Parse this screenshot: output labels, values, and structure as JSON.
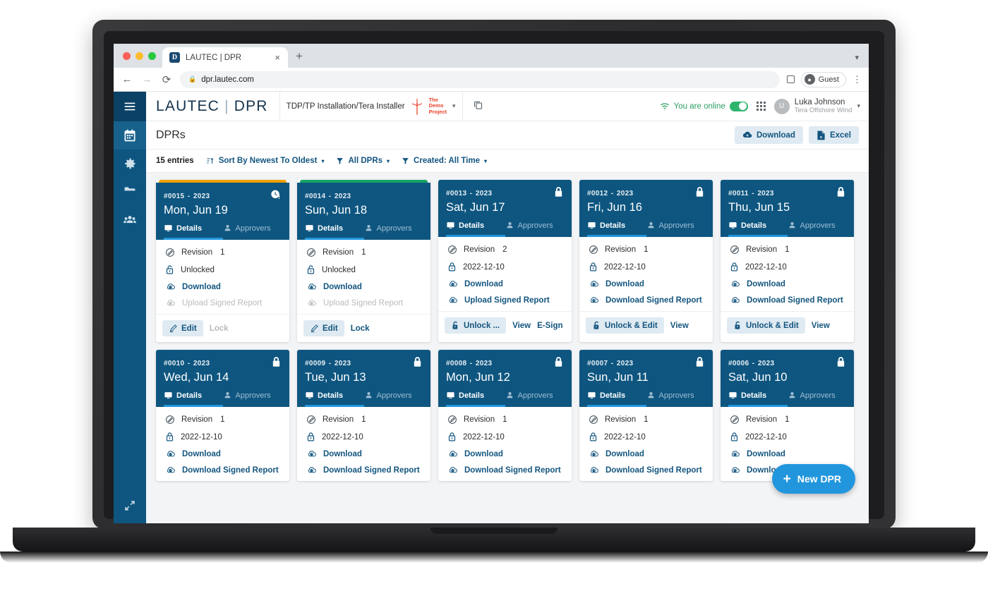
{
  "browser": {
    "tab_title": "LAUTEC | DPR",
    "tab_favicon_letter": "D",
    "new_tab_label": "+",
    "close_label": "×",
    "url": "dpr.lautec.com",
    "profile_label": "Guest"
  },
  "sidebar": {
    "items": [
      {
        "name": "menu-toggle",
        "icon": "hamburger-icon"
      },
      {
        "name": "calendar",
        "icon": "calendar-icon",
        "active": true
      },
      {
        "name": "settings",
        "icon": "gear-icon",
        "active": false
      },
      {
        "name": "files",
        "icon": "folder-icon",
        "active": false
      },
      {
        "name": "people",
        "icon": "people-icon",
        "active": false
      }
    ],
    "bottom_icon": "expand-arrows-icon"
  },
  "appbar": {
    "brand_primary": "LAUTEC",
    "brand_divider": "|",
    "brand_secondary": "DPR",
    "project_name": "TDP/TP Installation/Tera Installer",
    "project_badge_lines": [
      "The",
      "Demo",
      "Project"
    ],
    "project_caret": "▾",
    "copy_icon": "copy-icon",
    "online_text": "You are online",
    "online_color": "#2e9e62",
    "apps_icon": "app-grid-icon",
    "user_initial": "U",
    "user_name": "Luka Johnson",
    "user_org": "Tera Offshore Wind",
    "user_caret": "▾"
  },
  "page": {
    "title": "DPRs",
    "download_label": "Download",
    "excel_label": "Excel"
  },
  "filters": {
    "entries": "15 entries",
    "sort_label": "Sort By Newest To Oldest",
    "type_label": "All DPRs",
    "created_label": "Created: All Time",
    "caret": "▾"
  },
  "fab": {
    "label": "New DPR",
    "plus": "+",
    "color": "#2196dd"
  },
  "labels": {
    "details": "Details",
    "approvers": "Approvers",
    "revision": "Revision",
    "unlocked": "Unlocked",
    "download": "Download",
    "upload_signed": "Upload Signed Report",
    "download_signed": "Download Signed Report",
    "edit": "Edit",
    "lock": "Lock",
    "unlock_short": "Unlock ...",
    "unlock_edit": "Unlock & Edit",
    "view": "View",
    "esign": "E-Sign"
  },
  "cards": [
    {
      "id": "#0015",
      "sep": "-",
      "year": "2023",
      "date": "Mon, Jun 19",
      "accent": "orange",
      "status_icon": "clock-alert-icon",
      "revision": "1",
      "lock_row": "Unlocked",
      "lock_icon": "unlocked-icon",
      "download": "Download",
      "download_state": "link",
      "secondary": "Upload Signed Report",
      "secondary_state": "muted",
      "actions": [
        {
          "label": "Edit",
          "kind": "button",
          "icon": "pencil-icon"
        },
        {
          "label": "Lock",
          "kind": "link-muted"
        }
      ]
    },
    {
      "id": "#0014",
      "sep": "-",
      "year": "2023",
      "date": "Sun, Jun 18",
      "accent": "green",
      "status_icon": "",
      "revision": "1",
      "lock_row": "Unlocked",
      "lock_icon": "unlocked-icon",
      "download": "Download",
      "download_state": "link",
      "secondary": "Upload Signed Report",
      "secondary_state": "muted",
      "actions": [
        {
          "label": "Edit",
          "kind": "button",
          "icon": "pencil-icon"
        },
        {
          "label": "Lock",
          "kind": "link"
        }
      ]
    },
    {
      "id": "#0013",
      "sep": "-",
      "year": "2023",
      "date": "Sat, Jun 17",
      "accent": "none",
      "status_icon": "locked-icon",
      "revision": "2",
      "lock_row": "2022-12-10",
      "lock_icon": "locked-icon",
      "download": "Download",
      "download_state": "link",
      "secondary": "Upload Signed Report",
      "secondary_state": "link",
      "actions": [
        {
          "label": "Unlock ...",
          "kind": "button",
          "icon": "unlock-icon"
        },
        {
          "label": "View",
          "kind": "link"
        },
        {
          "label": "E-Sign",
          "kind": "link"
        }
      ]
    },
    {
      "id": "#0012",
      "sep": "-",
      "year": "2023",
      "date": "Fri, Jun 16",
      "accent": "none",
      "status_icon": "locked-icon",
      "revision": "1",
      "lock_row": "2022-12-10",
      "lock_icon": "locked-icon",
      "download": "Download",
      "download_state": "link",
      "secondary": "Download Signed Report",
      "secondary_state": "link",
      "actions": [
        {
          "label": "Unlock & Edit",
          "kind": "button",
          "icon": "unlock-icon"
        },
        {
          "label": "View",
          "kind": "link"
        }
      ]
    },
    {
      "id": "#0011",
      "sep": "-",
      "year": "2023",
      "date": "Thu, Jun 15",
      "accent": "none",
      "status_icon": "locked-icon",
      "revision": "1",
      "lock_row": "2022-12-10",
      "lock_icon": "locked-icon",
      "download": "Download",
      "download_state": "link",
      "secondary": "Download Signed Report",
      "secondary_state": "link",
      "actions": [
        {
          "label": "Unlock & Edit",
          "kind": "button",
          "icon": "unlock-icon"
        },
        {
          "label": "View",
          "kind": "link"
        }
      ]
    },
    {
      "id": "#0010",
      "sep": "-",
      "year": "2023",
      "date": "Wed, Jun 14",
      "accent": "none",
      "status_icon": "locked-icon",
      "revision": "1",
      "lock_row": "2022-12-10",
      "lock_icon": "locked-icon",
      "download": "Download",
      "download_state": "link",
      "secondary": "Download Signed Report",
      "secondary_state": "link",
      "actions": []
    },
    {
      "id": "#0009",
      "sep": "-",
      "year": "2023",
      "date": "Tue, Jun 13",
      "accent": "none",
      "status_icon": "locked-icon",
      "revision": "1",
      "lock_row": "2022-12-10",
      "lock_icon": "locked-icon",
      "download": "Download",
      "download_state": "link",
      "secondary": "Download Signed Report",
      "secondary_state": "link",
      "actions": []
    },
    {
      "id": "#0008",
      "sep": "-",
      "year": "2023",
      "date": "Mon, Jun 12",
      "accent": "none",
      "status_icon": "locked-icon",
      "revision": "1",
      "lock_row": "2022-12-10",
      "lock_icon": "locked-icon",
      "download": "Download",
      "download_state": "link",
      "secondary": "Download Signed Report",
      "secondary_state": "link",
      "actions": []
    },
    {
      "id": "#0007",
      "sep": "-",
      "year": "2023",
      "date": "Sun, Jun 11",
      "accent": "none",
      "status_icon": "locked-icon",
      "revision": "1",
      "lock_row": "2022-12-10",
      "lock_icon": "locked-icon",
      "download": "Download",
      "download_state": "link",
      "secondary": "Download Signed Report",
      "secondary_state": "link",
      "actions": []
    },
    {
      "id": "#0006",
      "sep": "-",
      "year": "2023",
      "date": "Sat, Jun 10",
      "accent": "none",
      "status_icon": "locked-icon",
      "revision": "1",
      "lock_row": "2022-12-10",
      "lock_icon": "locked-icon",
      "download": "Download",
      "download_state": "link",
      "secondary": "Download Signed Report",
      "secondary_state": "link",
      "actions": []
    }
  ]
}
